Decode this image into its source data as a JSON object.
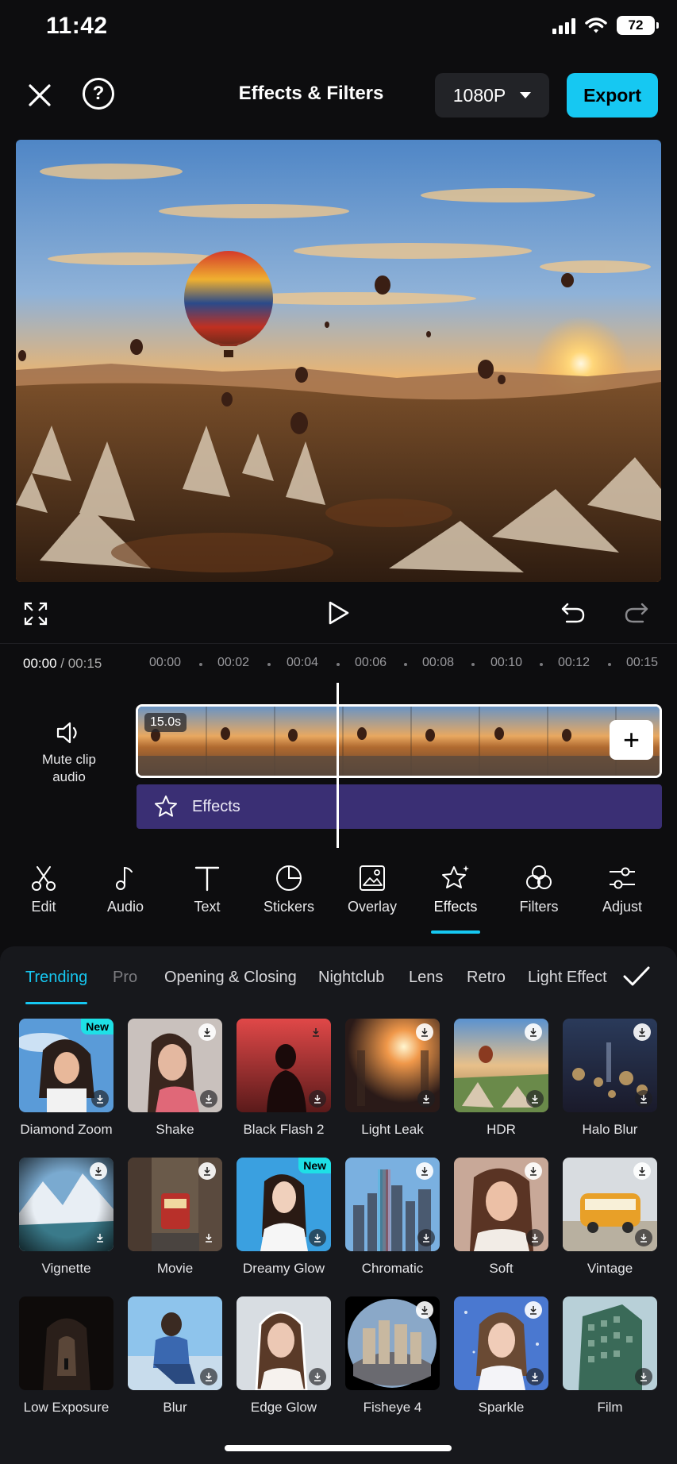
{
  "status": {
    "time": "11:42",
    "battery": "72"
  },
  "header": {
    "title": "Effects & Filters",
    "resolution": "1080P",
    "export_label": "Export"
  },
  "timeline": {
    "current": "00:00",
    "total": "/ 00:15",
    "ticks": [
      "00:00",
      "00:02",
      "00:04",
      "00:06",
      "00:08",
      "00:10",
      "00:12",
      "00:15"
    ],
    "clip_duration": "15.0s",
    "mute_label": "Mute clip audio",
    "effects_track_label": "Effects"
  },
  "toolbar": [
    {
      "label": "Edit",
      "icon": "scissors-icon"
    },
    {
      "label": "Audio",
      "icon": "music-note-icon"
    },
    {
      "label": "Text",
      "icon": "text-icon"
    },
    {
      "label": "Stickers",
      "icon": "sticker-icon"
    },
    {
      "label": "Overlay",
      "icon": "image-overlay-icon"
    },
    {
      "label": "Effects",
      "icon": "sparkle-star-icon",
      "active": true
    },
    {
      "label": "Filters",
      "icon": "filters-circles-icon"
    },
    {
      "label": "Adjust",
      "icon": "sliders-icon"
    }
  ],
  "categories": [
    "Trending",
    "Pro",
    "Opening & Closing",
    "Nightclub",
    "Lens",
    "Retro",
    "Light Effect"
  ],
  "active_category": "Trending",
  "effects": [
    {
      "label": "Diamond Zoom",
      "badge": "New"
    },
    {
      "label": "Shake"
    },
    {
      "label": "Black Flash 2"
    },
    {
      "label": "Light Leak"
    },
    {
      "label": "HDR"
    },
    {
      "label": "Halo Blur"
    },
    {
      "label": "Vignette"
    },
    {
      "label": "Movie"
    },
    {
      "label": "Dreamy Glow",
      "badge": "New"
    },
    {
      "label": "Chromatic"
    },
    {
      "label": "Soft"
    },
    {
      "label": "Vintage"
    },
    {
      "label": "Low Exposure"
    },
    {
      "label": "Blur"
    },
    {
      "label": "Edge Glow"
    },
    {
      "label": "Fisheye 4"
    },
    {
      "label": "Sparkle"
    },
    {
      "label": "Film"
    }
  ],
  "colors": {
    "accent": "#16c8f2",
    "effects_track": "#3a2f74",
    "badge": "#1ee0e6"
  }
}
